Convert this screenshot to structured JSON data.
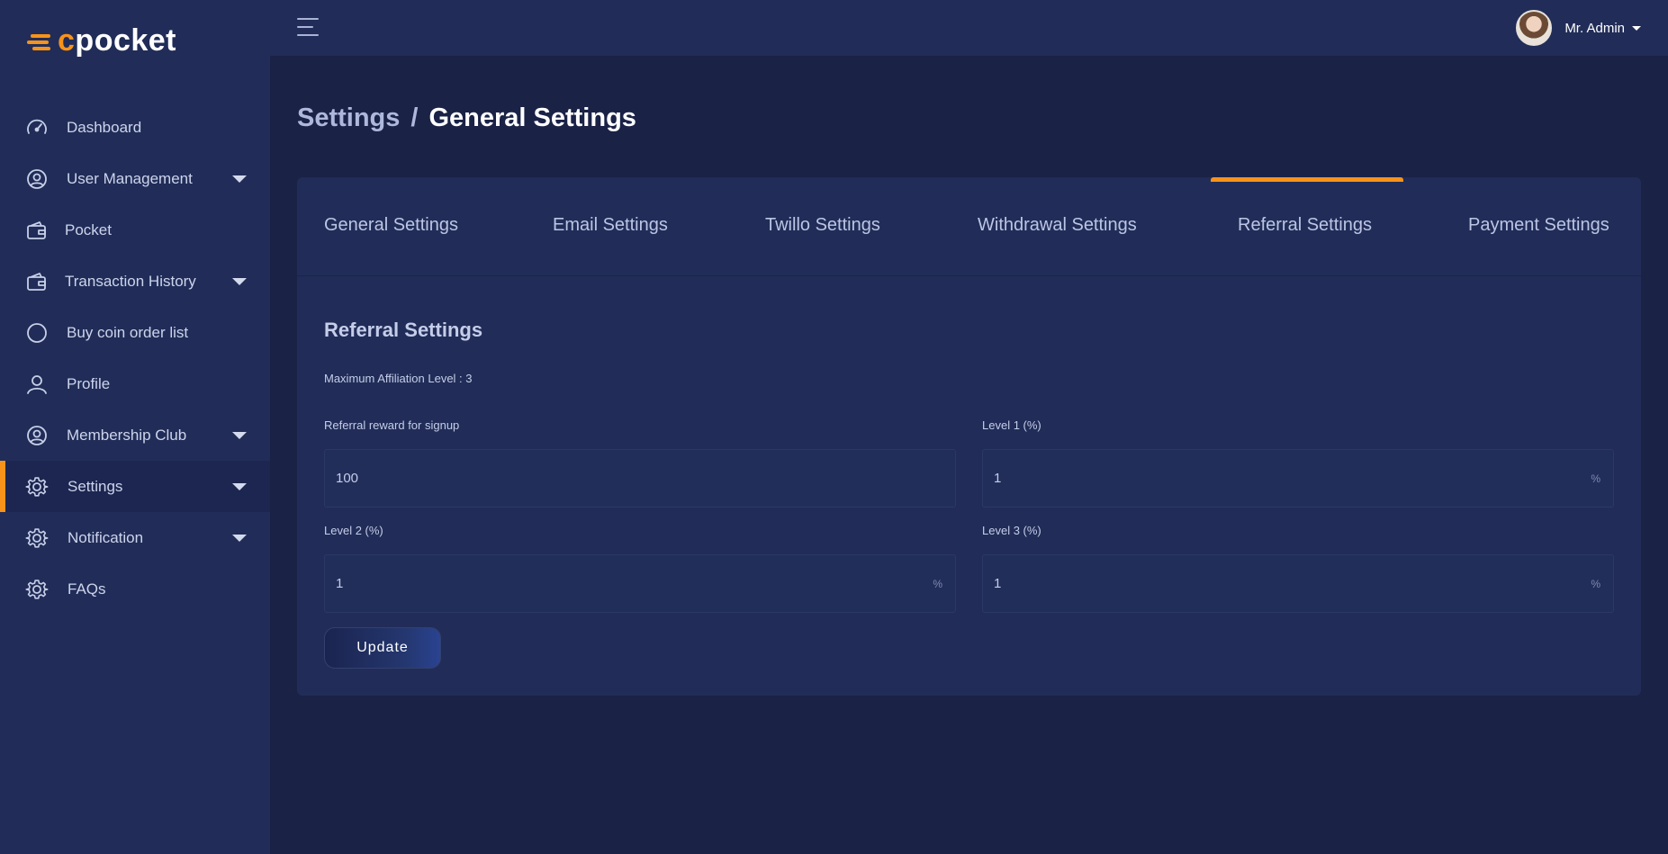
{
  "brand": {
    "logo_c": "c",
    "logo_rest": "pocket",
    "accent": "#f7931a"
  },
  "topbar": {
    "user_name": "Mr. Admin"
  },
  "sidebar": {
    "items": [
      {
        "label": "Dashboard",
        "icon": "gauge-icon",
        "has_caret": false
      },
      {
        "label": "User Management",
        "icon": "user-circle-icon",
        "has_caret": true
      },
      {
        "label": "Pocket",
        "icon": "wallet-icon",
        "has_caret": false
      },
      {
        "label": "Transaction History",
        "icon": "wallet-icon",
        "has_caret": true
      },
      {
        "label": "Buy coin order list",
        "icon": "circle-icon",
        "has_caret": false
      },
      {
        "label": "Profile",
        "icon": "person-icon",
        "has_caret": false
      },
      {
        "label": "Membership Club",
        "icon": "user-circle-icon",
        "has_caret": true
      },
      {
        "label": "Settings",
        "icon": "gear-icon",
        "has_caret": true,
        "active": true
      },
      {
        "label": "Notification",
        "icon": "gear-icon",
        "has_caret": true
      },
      {
        "label": "FAQs",
        "icon": "gear-icon",
        "has_caret": false
      }
    ]
  },
  "breadcrumb": {
    "parent": "Settings",
    "separator": "/",
    "current": "General Settings"
  },
  "tabs": [
    {
      "label": "General Settings"
    },
    {
      "label": "Email Settings"
    },
    {
      "label": "Twillo Settings"
    },
    {
      "label": "Withdrawal Settings"
    },
    {
      "label": "Referral Settings",
      "active": true
    },
    {
      "label": "Payment Settings"
    }
  ],
  "form": {
    "title": "Referral Settings",
    "info": "Maximum Affiliation Level : 3",
    "fields": {
      "signup_reward": {
        "label": "Referral reward for signup",
        "value": "100"
      },
      "level1": {
        "label": "Level 1 (%)",
        "value": "1",
        "suffix": "%"
      },
      "level2": {
        "label": "Level 2 (%)",
        "value": "1",
        "suffix": "%"
      },
      "level3": {
        "label": "Level 3 (%)",
        "value": "1",
        "suffix": "%"
      }
    },
    "submit_label": "Update"
  }
}
